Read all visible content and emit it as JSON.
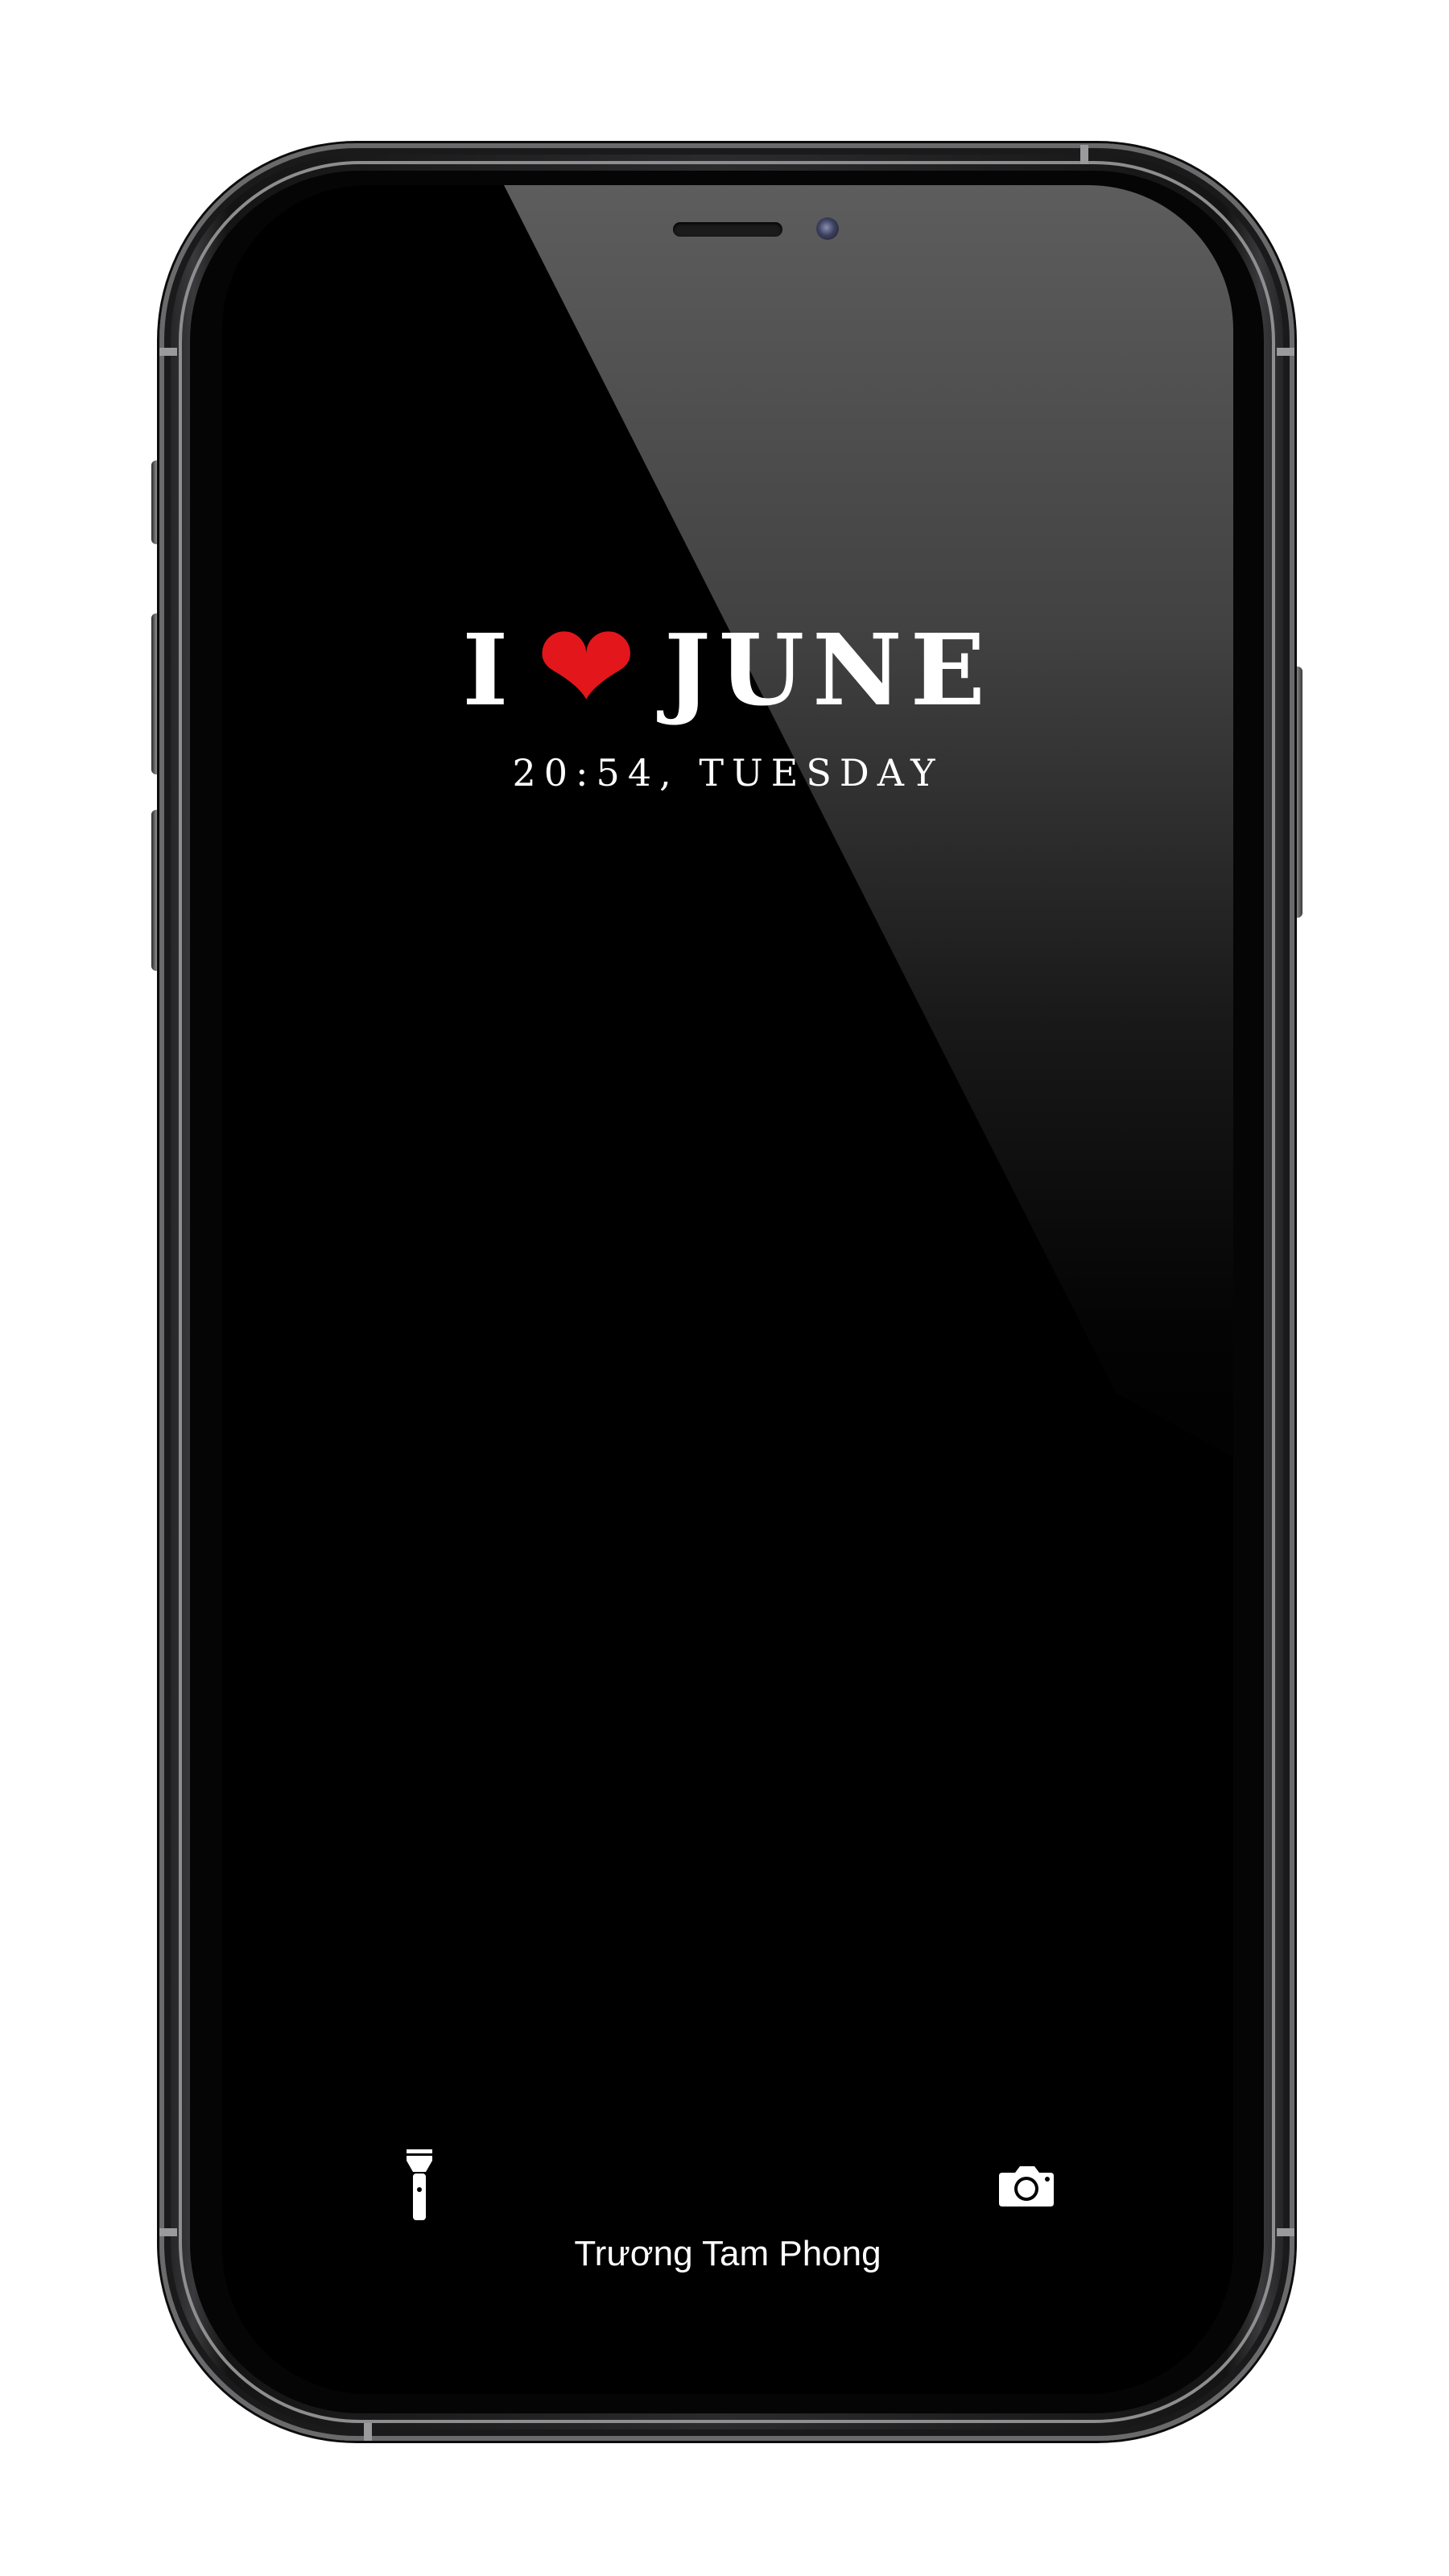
{
  "lock_screen": {
    "title_prefix": "I",
    "title_heart": "❤",
    "title_month": "JUNE",
    "time_day": "20:54, TUESDAY",
    "owner_name": "Trương Tam Phong"
  },
  "controls": {
    "flashlight_icon": "flashlight-icon",
    "camera_icon": "camera-icon"
  },
  "colors": {
    "screen": "#000000",
    "text": "#ffffff",
    "heart": "#e3161b",
    "frame": "#1c1c1e"
  }
}
